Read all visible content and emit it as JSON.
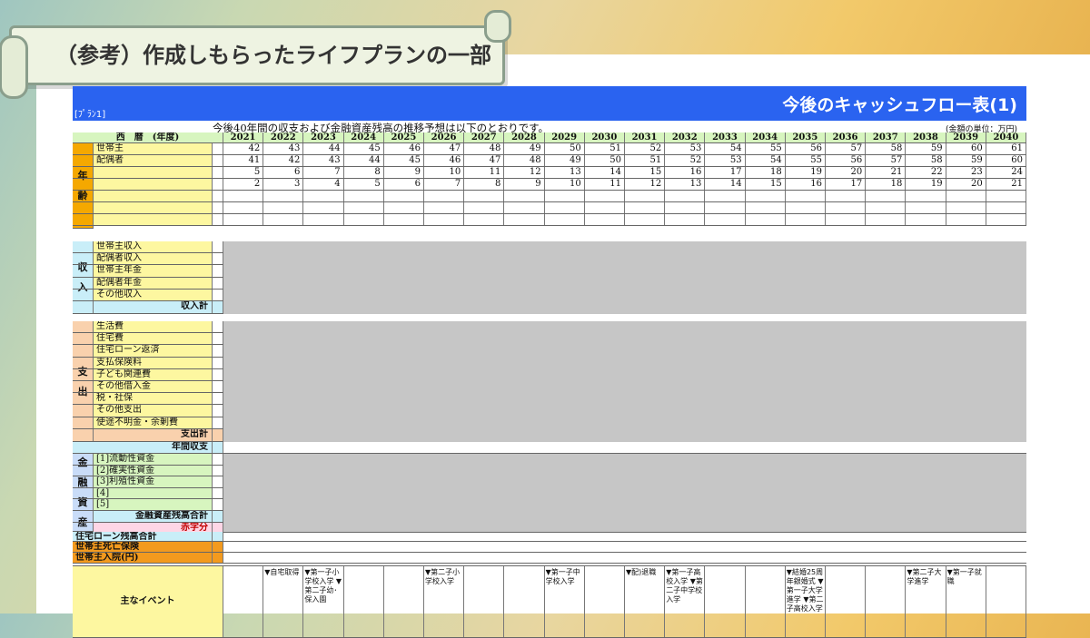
{
  "slide_title": "（参考）作成しもらったライフプランの一部",
  "plan_label": "[ﾌﾟﾗﾝ1]",
  "table_title": "今後のキャッシュフロー表(1)",
  "note": "今後40年間の収支および金融資産残高の推移予想は以下のとおりです。",
  "unit_note": "(金額の単位：万円)",
  "header_label": "西　暦　(年度)",
  "years": [
    "2021",
    "2022",
    "2023",
    "2024",
    "2025",
    "2026",
    "2027",
    "2028",
    "2029",
    "2030",
    "2031",
    "2032",
    "2033",
    "2034",
    "2035",
    "2036",
    "2037",
    "2038",
    "2039",
    "2040"
  ],
  "age_section": "年齢",
  "age_rows": [
    {
      "label": "世帯主",
      "values": [
        42,
        43,
        44,
        45,
        46,
        47,
        48,
        49,
        50,
        51,
        52,
        53,
        54,
        55,
        56,
        57,
        58,
        59,
        60,
        61
      ]
    },
    {
      "label": "配偶者",
      "values": [
        41,
        42,
        43,
        44,
        45,
        46,
        47,
        48,
        49,
        50,
        51,
        52,
        53,
        54,
        55,
        56,
        57,
        58,
        59,
        60
      ]
    },
    {
      "label": "",
      "values": [
        5,
        6,
        7,
        8,
        9,
        10,
        11,
        12,
        13,
        14,
        15,
        16,
        17,
        18,
        19,
        20,
        21,
        22,
        23,
        24
      ]
    },
    {
      "label": "",
      "values": [
        2,
        3,
        4,
        5,
        6,
        7,
        8,
        9,
        10,
        11,
        12,
        13,
        14,
        15,
        16,
        17,
        18,
        19,
        20,
        21
      ]
    }
  ],
  "income_section": "収入",
  "income_rows": [
    "世帯主収入",
    "配偶者収入",
    "世帯主年金",
    "配偶者年金",
    "その他収入"
  ],
  "income_total": "収入計",
  "expense_section": "支出",
  "expense_rows": [
    "生活費",
    "住宅費",
    "住宅ローン返済",
    "支払保険料",
    "子ども関連費",
    "その他借入金",
    "税・社保",
    "その他支出",
    "使途不明金・余剰費"
  ],
  "expense_total": "支出計",
  "annual_balance": "年間収支",
  "asset_section": "金融資産",
  "asset_rows": [
    "[1]流動性資金",
    "[2]確実性資金",
    "[3]利殖性資金",
    "[4]",
    "[5]"
  ],
  "asset_total": "金融資産残高合計",
  "deficit": "赤字分",
  "loan_balance": "住宅ローン残高合計",
  "death_insurance": "世帯主死亡保険",
  "hospital": "世帯主入院(円)",
  "events_label": "主なイベント",
  "events": [
    {
      "year": "2022",
      "text": "▼自宅取得"
    },
    {
      "year": "2023",
      "text": "▼第一子小学校入学 ▼第二子幼･保入園"
    },
    {
      "year": "2026",
      "text": "▼第二子小学校入学"
    },
    {
      "year": "2029",
      "text": "▼第一子中学校入学"
    },
    {
      "year": "2031",
      "text": "▼配)退職"
    },
    {
      "year": "2032",
      "text": "▼第一子高校入学 ▼第二子中学校入学"
    },
    {
      "year": "2035",
      "text": "▼結婚25周年銀婚式 ▼第一子大学進学 ▼第二子高校入学"
    },
    {
      "year": "2038",
      "text": "▼第二子大学進学"
    },
    {
      "year": "2039",
      "text": "▼第一子就職"
    }
  ],
  "colors": {
    "header_bar": "#2a63f0",
    "age": "#f5a800",
    "income_section": "#c9eef8",
    "expense_section": "#f9d1ad",
    "asset_section": "#c9dcf8",
    "labels_yellow": "#fdf7a0",
    "shaded": "#c6c6c6",
    "orange_rows": "#f39a1e"
  }
}
